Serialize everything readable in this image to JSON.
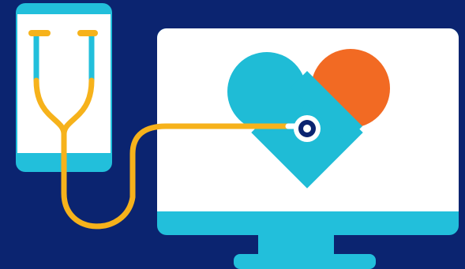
{
  "scene": {
    "subject": "telehealth",
    "objects": [
      "smartphone-icon",
      "stethoscope-icon",
      "desktop-monitor-icon",
      "heart-icon"
    ]
  },
  "colors": {
    "background": "#0b2470",
    "device_frame": "#22bfdb",
    "screen": "#ffffff",
    "heart_blue": "#1fbcd6",
    "heart_orange": "#f26a23",
    "stethoscope": "#f6b21b",
    "chestpiece_ring": "#0b2470"
  }
}
